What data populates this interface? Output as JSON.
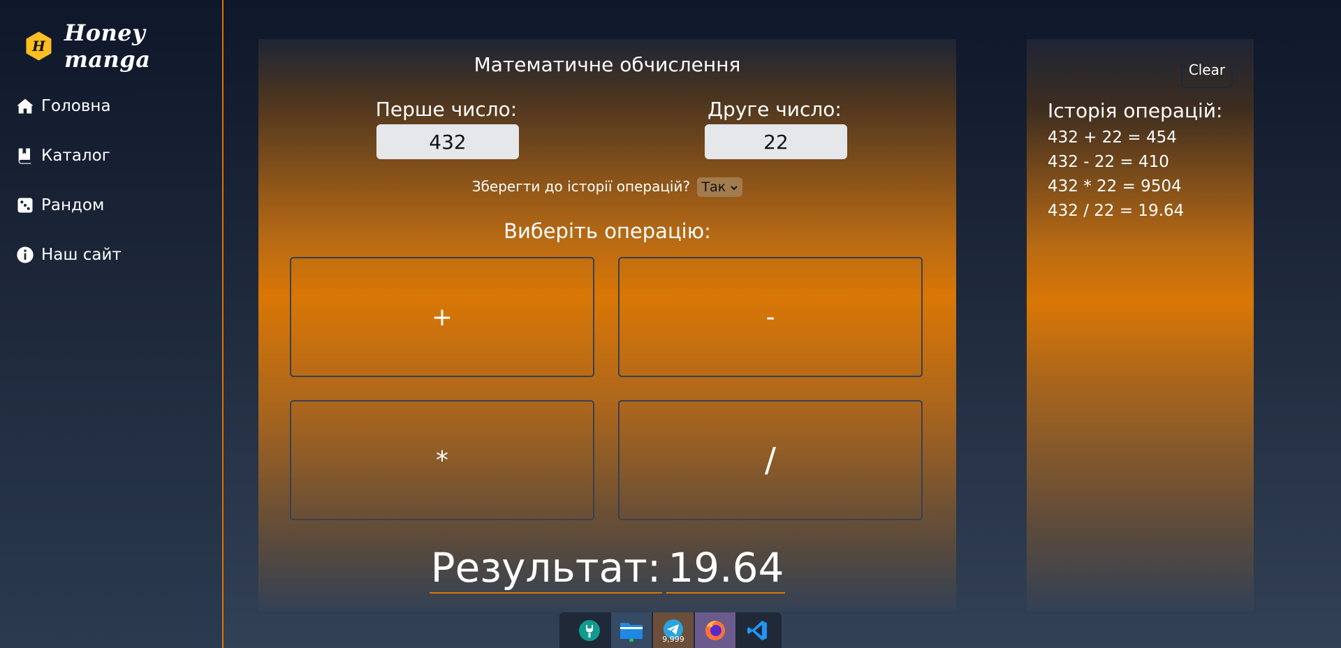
{
  "sidebar": {
    "logo_letter": "H",
    "logo_text": "Honey manga",
    "items": [
      {
        "label": "Головна",
        "icon": "home-icon"
      },
      {
        "label": "Каталог",
        "icon": "book-icon"
      },
      {
        "label": "Рандом",
        "icon": "dice-icon"
      },
      {
        "label": "Наш сайт",
        "icon": "info-icon"
      }
    ]
  },
  "calculator": {
    "title": "Математичне обчислення",
    "first_label": "Перше число:",
    "first_value": "432",
    "second_label": "Друге число:",
    "second_value": "22",
    "save_question": "Зберегти до історії операцій?",
    "save_selected": "Так",
    "operation_title": "Виберіть операцію:",
    "ops": {
      "add": "+",
      "sub": "-",
      "mul": "*",
      "div": "/"
    },
    "result_label": "Результат:",
    "result_value": "19.64"
  },
  "history": {
    "clear_label": "Clear",
    "title": "Історія операцій:",
    "entries": [
      "432 + 22 = 454",
      "432 - 22 = 410",
      "432 * 22 = 9504",
      "432 / 22 = 19.64"
    ]
  },
  "taskbar": {
    "apps": [
      "settings-app",
      "files-app",
      "telegram-app",
      "firefox-app",
      "vscode-app"
    ],
    "telegram_badge": "9,999"
  },
  "colors": {
    "accent": "#d97706",
    "logo": "#fbbf24"
  }
}
